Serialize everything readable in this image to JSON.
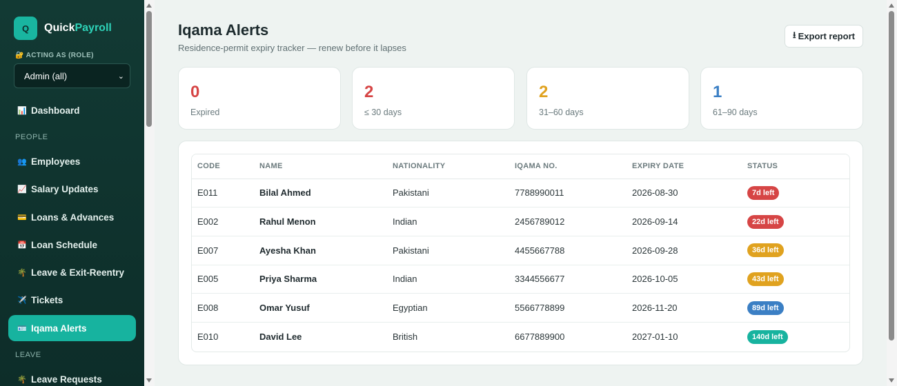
{
  "app": {
    "logo_letter": "Q",
    "name_part1": "Quick",
    "name_part2": "Payroll"
  },
  "role": {
    "label": "🔐 ACTING AS (ROLE)",
    "selected": "Admin (all)"
  },
  "nav": {
    "dashboard": {
      "icon": "📊",
      "label": "Dashboard"
    },
    "section_people": "PEOPLE",
    "employees": {
      "icon": "👥",
      "label": "Employees"
    },
    "salary_updates": {
      "icon": "📈",
      "label": "Salary Updates"
    },
    "loans": {
      "icon": "💳",
      "label": "Loans & Advances"
    },
    "loan_schedule": {
      "icon": "📅",
      "label": "Loan Schedule"
    },
    "leave_exit": {
      "icon": "🌴",
      "label": "Leave & Exit-Reentry"
    },
    "tickets": {
      "icon": "✈️",
      "label": "Tickets"
    },
    "iqama_alerts": {
      "icon": "🪪",
      "label": "Iqama Alerts"
    },
    "section_leave": "LEAVE",
    "leave_requests": {
      "icon": "🌴",
      "label": "Leave Requests"
    }
  },
  "header": {
    "title": "Iqama Alerts",
    "subtitle": "Residence-permit expiry tracker — renew before it lapses",
    "export_icon": "⭳",
    "export_label": "Export report"
  },
  "stats": [
    {
      "value": "0",
      "label": "Expired",
      "color": "#d64545"
    },
    {
      "value": "2",
      "label": "≤ 30 days",
      "color": "#d64545"
    },
    {
      "value": "2",
      "label": "31–60 days",
      "color": "#e0a21f"
    },
    {
      "value": "1",
      "label": "61–90 days",
      "color": "#3b7fc4"
    }
  ],
  "table": {
    "headers": [
      "CODE",
      "NAME",
      "NATIONALITY",
      "IQAMA NO.",
      "EXPIRY DATE",
      "STATUS"
    ],
    "rows": [
      {
        "code": "E011",
        "name": "Bilal Ahmed",
        "nationality": "Pakistani",
        "iqama": "7788990011",
        "expiry": "2026-08-30",
        "status": "7d left",
        "status_color": "#d64545"
      },
      {
        "code": "E002",
        "name": "Rahul Menon",
        "nationality": "Indian",
        "iqama": "2456789012",
        "expiry": "2026-09-14",
        "status": "22d left",
        "status_color": "#d64545"
      },
      {
        "code": "E007",
        "name": "Ayesha Khan",
        "nationality": "Pakistani",
        "iqama": "4455667788",
        "expiry": "2026-09-28",
        "status": "36d left",
        "status_color": "#e0a21f"
      },
      {
        "code": "E005",
        "name": "Priya Sharma",
        "nationality": "Indian",
        "iqama": "3344556677",
        "expiry": "2026-10-05",
        "status": "43d left",
        "status_color": "#e0a21f"
      },
      {
        "code": "E008",
        "name": "Omar Yusuf",
        "nationality": "Egyptian",
        "iqama": "5566778899",
        "expiry": "2026-11-20",
        "status": "89d left",
        "status_color": "#3b7fc4"
      },
      {
        "code": "E010",
        "name": "David Lee",
        "nationality": "British",
        "iqama": "6677889900",
        "expiry": "2027-01-10",
        "status": "140d left",
        "status_color": "#17b39f"
      }
    ]
  }
}
